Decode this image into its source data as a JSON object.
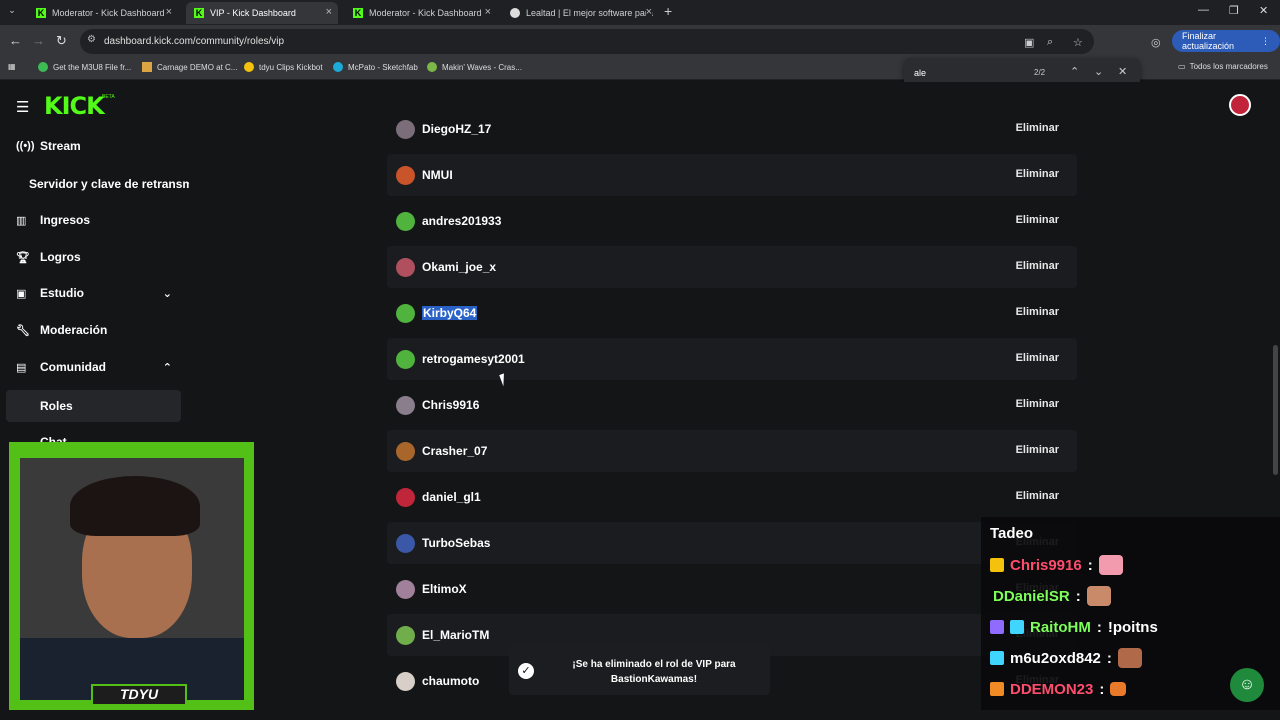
{
  "browser": {
    "tabs": [
      {
        "title": "Moderator - Kick Dashboard"
      },
      {
        "title": "VIP - Kick Dashboard"
      },
      {
        "title": "Moderator - Kick Dashboard"
      },
      {
        "title": "Lealtad | El mejor software para"
      }
    ],
    "url": "dashboard.kick.com/community/roles/vip",
    "finish_update_label": "Finalizar actualización",
    "bookmarks": [
      {
        "label": "Get the M3U8 File fr...",
        "color": "#3cba54"
      },
      {
        "label": "Carnage DEMO at C...",
        "color": "#d9a441"
      },
      {
        "label": "tdyu Clips Kickbot",
        "color": "#f4c20d"
      },
      {
        "label": "McPato - Sketchfab",
        "color": "#1caad9"
      },
      {
        "label": "Makin' Waves - Cras...",
        "color": "#7ab648"
      }
    ],
    "all_bookmarks_label": "Todos los marcadores",
    "find": {
      "query": "ale",
      "count": "2/2"
    }
  },
  "kick": {
    "logo": "KICK",
    "logo_beta": "BETA",
    "accent": "#53fc18"
  },
  "sidebar": {
    "items": [
      {
        "label": "Stream",
        "icon": "broadcast-icon"
      },
      {
        "label": "Servidor y clave de retransm"
      },
      {
        "label": "Ingresos",
        "icon": "chart-icon"
      },
      {
        "label": "Logros",
        "icon": "trophy-icon"
      },
      {
        "label": "Estudio",
        "icon": "studio-icon"
      },
      {
        "label": "Moderación",
        "icon": "wrench-icon"
      },
      {
        "label": "Comunidad",
        "icon": "community-icon"
      },
      {
        "label": "Roles"
      },
      {
        "label": "Chat"
      }
    ]
  },
  "vip_list": {
    "remove_label": "Eliminar",
    "users": [
      {
        "name": "DiegoHZ_17",
        "color": "#7b6e7a"
      },
      {
        "name": "NMUI",
        "color": "#c9542a"
      },
      {
        "name": "andres201933",
        "color": "#4fb33e"
      },
      {
        "name": "Okami_joe_x",
        "color": "#b0505e"
      },
      {
        "name": "KirbyQ64",
        "color": "#4fb33e"
      },
      {
        "name": "retrogamesyt2001",
        "color": "#4fb33e"
      },
      {
        "name": "Chris9916",
        "color": "#8a7d8c"
      },
      {
        "name": "Crasher_07",
        "color": "#a8662b"
      },
      {
        "name": "daniel_gl1",
        "color": "#c0263a"
      },
      {
        "name": "TurboSebas",
        "color": "#3b57a8"
      },
      {
        "name": "EltimoX",
        "color": "#a0809a"
      },
      {
        "name": "El_MarioTM",
        "color": "#6fae4a"
      },
      {
        "name": "chaumoto",
        "color": "#d8d0c8"
      }
    ]
  },
  "toast": {
    "message": "¡Se ha eliminado el rol de VIP para BastionKawamas!"
  },
  "webcam": {
    "name_tag": "TDYU"
  },
  "chat": {
    "header": "Tadeo",
    "messages": [
      {
        "user": "Chris9916",
        "user_color": "#ff4d6d",
        "text": "",
        "badge": "#f4c20d"
      },
      {
        "user": "DDanielSR",
        "user_color": "#7dff5a",
        "text": "",
        "badge": ""
      },
      {
        "user": "RaitoHM",
        "user_color": "#7dff5a",
        "text": "!poitns",
        "badge": "#8f6cff"
      },
      {
        "user": "m6u2oxd842",
        "user_color": "#ffffff",
        "text": "",
        "badge": "#3fd5ff"
      },
      {
        "user": "DDEMON23",
        "user_color": "#ff4d6d",
        "text": "",
        "badge": "#f08a24"
      }
    ]
  }
}
